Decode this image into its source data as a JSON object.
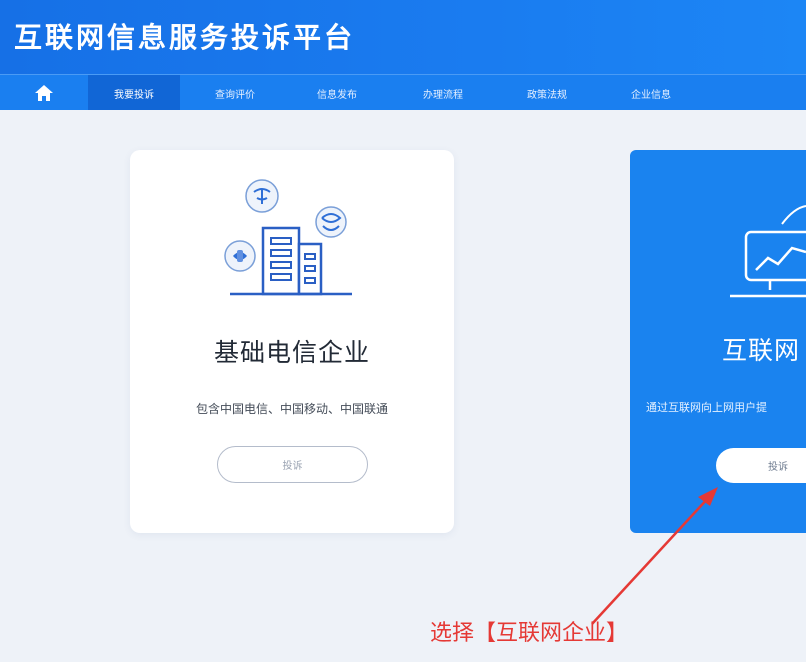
{
  "header": {
    "site_title": "互联网信息服务投诉平台"
  },
  "nav": {
    "home_icon": "home-icon",
    "items": [
      {
        "label": "我要投诉",
        "active": true
      },
      {
        "label": "查询评价",
        "active": false
      },
      {
        "label": "信息发布",
        "active": false
      },
      {
        "label": "办理流程",
        "active": false
      },
      {
        "label": "政策法规",
        "active": false
      },
      {
        "label": "企业信息",
        "active": false
      }
    ]
  },
  "cards": {
    "left": {
      "title": "基础电信企业",
      "description": "包含中国电信、中国移动、中国联通",
      "button_label": "投诉",
      "icons": [
        "telecom-logo-icon",
        "buildings-icon",
        "mobile-logo-icon",
        "unicom-logo-icon"
      ]
    },
    "right": {
      "title": "互联网",
      "description": "通过互联网向上网用户提",
      "button_label": "投诉",
      "icons": [
        "monitor-chart-icon"
      ]
    }
  },
  "annotation": {
    "text": "选择【互联网企业】",
    "color": "#e53935"
  },
  "colors": {
    "header_blue": "#1a7ff0",
    "card_blue": "#1a83ef",
    "accent_red": "#e53935"
  }
}
